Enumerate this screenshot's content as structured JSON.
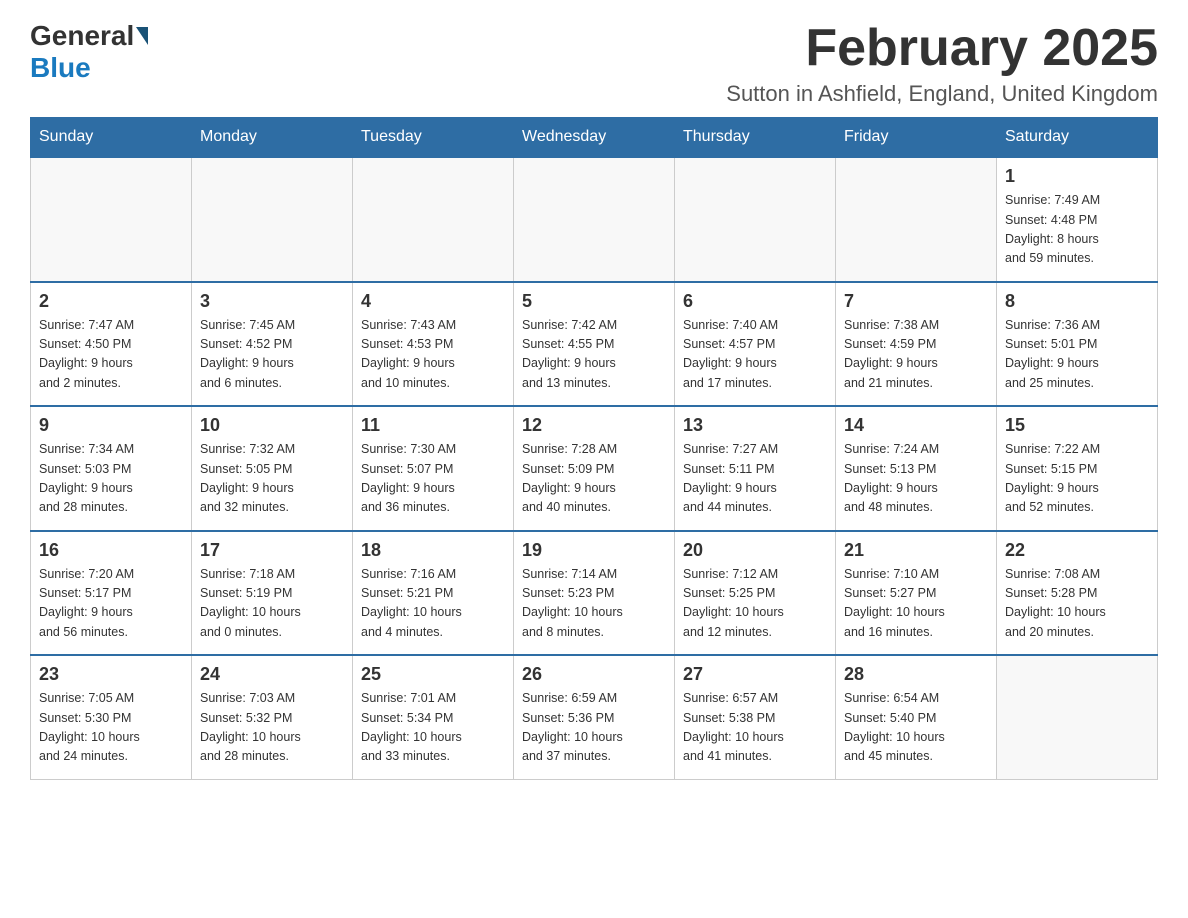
{
  "header": {
    "logo_general": "General",
    "logo_blue": "Blue",
    "month_title": "February 2025",
    "location": "Sutton in Ashfield, England, United Kingdom"
  },
  "days_of_week": [
    "Sunday",
    "Monday",
    "Tuesday",
    "Wednesday",
    "Thursday",
    "Friday",
    "Saturday"
  ],
  "weeks": [
    [
      {
        "day": "",
        "info": ""
      },
      {
        "day": "",
        "info": ""
      },
      {
        "day": "",
        "info": ""
      },
      {
        "day": "",
        "info": ""
      },
      {
        "day": "",
        "info": ""
      },
      {
        "day": "",
        "info": ""
      },
      {
        "day": "1",
        "info": "Sunrise: 7:49 AM\nSunset: 4:48 PM\nDaylight: 8 hours\nand 59 minutes."
      }
    ],
    [
      {
        "day": "2",
        "info": "Sunrise: 7:47 AM\nSunset: 4:50 PM\nDaylight: 9 hours\nand 2 minutes."
      },
      {
        "day": "3",
        "info": "Sunrise: 7:45 AM\nSunset: 4:52 PM\nDaylight: 9 hours\nand 6 minutes."
      },
      {
        "day": "4",
        "info": "Sunrise: 7:43 AM\nSunset: 4:53 PM\nDaylight: 9 hours\nand 10 minutes."
      },
      {
        "day": "5",
        "info": "Sunrise: 7:42 AM\nSunset: 4:55 PM\nDaylight: 9 hours\nand 13 minutes."
      },
      {
        "day": "6",
        "info": "Sunrise: 7:40 AM\nSunset: 4:57 PM\nDaylight: 9 hours\nand 17 minutes."
      },
      {
        "day": "7",
        "info": "Sunrise: 7:38 AM\nSunset: 4:59 PM\nDaylight: 9 hours\nand 21 minutes."
      },
      {
        "day": "8",
        "info": "Sunrise: 7:36 AM\nSunset: 5:01 PM\nDaylight: 9 hours\nand 25 minutes."
      }
    ],
    [
      {
        "day": "9",
        "info": "Sunrise: 7:34 AM\nSunset: 5:03 PM\nDaylight: 9 hours\nand 28 minutes."
      },
      {
        "day": "10",
        "info": "Sunrise: 7:32 AM\nSunset: 5:05 PM\nDaylight: 9 hours\nand 32 minutes."
      },
      {
        "day": "11",
        "info": "Sunrise: 7:30 AM\nSunset: 5:07 PM\nDaylight: 9 hours\nand 36 minutes."
      },
      {
        "day": "12",
        "info": "Sunrise: 7:28 AM\nSunset: 5:09 PM\nDaylight: 9 hours\nand 40 minutes."
      },
      {
        "day": "13",
        "info": "Sunrise: 7:27 AM\nSunset: 5:11 PM\nDaylight: 9 hours\nand 44 minutes."
      },
      {
        "day": "14",
        "info": "Sunrise: 7:24 AM\nSunset: 5:13 PM\nDaylight: 9 hours\nand 48 minutes."
      },
      {
        "day": "15",
        "info": "Sunrise: 7:22 AM\nSunset: 5:15 PM\nDaylight: 9 hours\nand 52 minutes."
      }
    ],
    [
      {
        "day": "16",
        "info": "Sunrise: 7:20 AM\nSunset: 5:17 PM\nDaylight: 9 hours\nand 56 minutes."
      },
      {
        "day": "17",
        "info": "Sunrise: 7:18 AM\nSunset: 5:19 PM\nDaylight: 10 hours\nand 0 minutes."
      },
      {
        "day": "18",
        "info": "Sunrise: 7:16 AM\nSunset: 5:21 PM\nDaylight: 10 hours\nand 4 minutes."
      },
      {
        "day": "19",
        "info": "Sunrise: 7:14 AM\nSunset: 5:23 PM\nDaylight: 10 hours\nand 8 minutes."
      },
      {
        "day": "20",
        "info": "Sunrise: 7:12 AM\nSunset: 5:25 PM\nDaylight: 10 hours\nand 12 minutes."
      },
      {
        "day": "21",
        "info": "Sunrise: 7:10 AM\nSunset: 5:27 PM\nDaylight: 10 hours\nand 16 minutes."
      },
      {
        "day": "22",
        "info": "Sunrise: 7:08 AM\nSunset: 5:28 PM\nDaylight: 10 hours\nand 20 minutes."
      }
    ],
    [
      {
        "day": "23",
        "info": "Sunrise: 7:05 AM\nSunset: 5:30 PM\nDaylight: 10 hours\nand 24 minutes."
      },
      {
        "day": "24",
        "info": "Sunrise: 7:03 AM\nSunset: 5:32 PM\nDaylight: 10 hours\nand 28 minutes."
      },
      {
        "day": "25",
        "info": "Sunrise: 7:01 AM\nSunset: 5:34 PM\nDaylight: 10 hours\nand 33 minutes."
      },
      {
        "day": "26",
        "info": "Sunrise: 6:59 AM\nSunset: 5:36 PM\nDaylight: 10 hours\nand 37 minutes."
      },
      {
        "day": "27",
        "info": "Sunrise: 6:57 AM\nSunset: 5:38 PM\nDaylight: 10 hours\nand 41 minutes."
      },
      {
        "day": "28",
        "info": "Sunrise: 6:54 AM\nSunset: 5:40 PM\nDaylight: 10 hours\nand 45 minutes."
      },
      {
        "day": "",
        "info": ""
      }
    ]
  ]
}
